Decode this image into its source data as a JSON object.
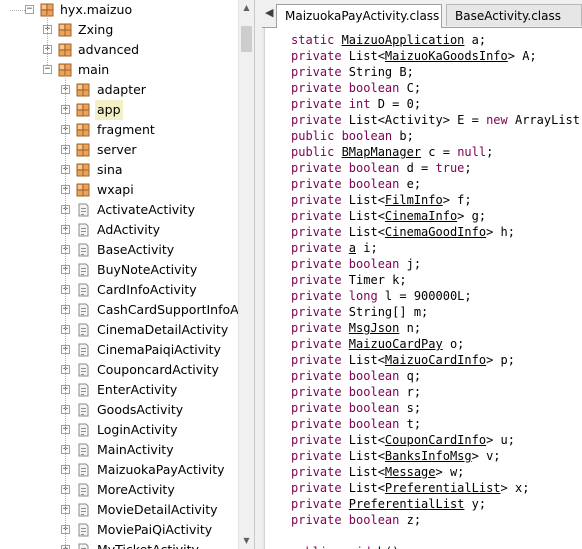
{
  "package_explorer": {
    "root": "hyx.maizuo",
    "packages": [
      {
        "label": "Zxing",
        "level": 1
      },
      {
        "label": "advanced",
        "level": 1
      },
      {
        "label": "main",
        "level": 1
      }
    ],
    "main_children": [
      {
        "label": "adapter",
        "type": "package"
      },
      {
        "label": "app",
        "type": "package",
        "selected": true
      },
      {
        "label": "fragment",
        "type": "package"
      },
      {
        "label": "server",
        "type": "package"
      },
      {
        "label": "sina",
        "type": "package"
      },
      {
        "label": "wxapi",
        "type": "package"
      },
      {
        "label": "ActivateActivity",
        "type": "class"
      },
      {
        "label": "AdActivity",
        "type": "class"
      },
      {
        "label": "BaseActivity",
        "type": "class"
      },
      {
        "label": "BuyNoteActivity",
        "type": "class"
      },
      {
        "label": "CardInfoActivity",
        "type": "class"
      },
      {
        "label": "CashCardSupportInfoAc",
        "type": "class"
      },
      {
        "label": "CinemaDetailActivity",
        "type": "class"
      },
      {
        "label": "CinemaPaiqiActivity",
        "type": "class"
      },
      {
        "label": "CouponcardActivity",
        "type": "class"
      },
      {
        "label": "EnterActivity",
        "type": "class"
      },
      {
        "label": "GoodsActivity",
        "type": "class"
      },
      {
        "label": "LoginActivity",
        "type": "class"
      },
      {
        "label": "MainActivity",
        "type": "class"
      },
      {
        "label": "MaizuokaPayActivity",
        "type": "class"
      },
      {
        "label": "MoreActivity",
        "type": "class"
      },
      {
        "label": "MovieDetailActivity",
        "type": "class"
      },
      {
        "label": "MoviePaiQiActivity",
        "type": "class"
      },
      {
        "label": "MyTicketActivity",
        "type": "class"
      }
    ]
  },
  "tabs": [
    {
      "label": "MaizuokaPayActivity.class",
      "active": true
    },
    {
      "label": "BaseActivity.class",
      "active": false
    }
  ],
  "code_lines": [
    [
      {
        "t": "static ",
        "k": 1
      },
      {
        "t": "MaizuoApplication",
        "u": 1
      },
      {
        "t": " a;"
      }
    ],
    [
      {
        "t": "private ",
        "k": 1
      },
      {
        "t": "List<"
      },
      {
        "t": "MaizuoKaGoodsInfo",
        "u": 1
      },
      {
        "t": "> A;"
      }
    ],
    [
      {
        "t": "private ",
        "k": 1
      },
      {
        "t": "String B;"
      }
    ],
    [
      {
        "t": "private ",
        "k": 1
      },
      {
        "t": "boolean ",
        "k": 1
      },
      {
        "t": "C;"
      }
    ],
    [
      {
        "t": "private ",
        "k": 1
      },
      {
        "t": "int ",
        "k": 1
      },
      {
        "t": "D = 0;"
      }
    ],
    [
      {
        "t": "private ",
        "k": 1
      },
      {
        "t": "List<Activity> E = "
      },
      {
        "t": "new ",
        "k": 1
      },
      {
        "t": "ArrayList();"
      }
    ],
    [
      {
        "t": "public ",
        "k": 1
      },
      {
        "t": "boolean ",
        "k": 1
      },
      {
        "t": "b;"
      }
    ],
    [
      {
        "t": "public ",
        "k": 1
      },
      {
        "t": "BMapManager",
        "u": 1
      },
      {
        "t": " c = "
      },
      {
        "t": "null",
        "k": 1
      },
      {
        "t": ";"
      }
    ],
    [
      {
        "t": "private ",
        "k": 1
      },
      {
        "t": "boolean ",
        "k": 1
      },
      {
        "t": "d = "
      },
      {
        "t": "true",
        "k": 1
      },
      {
        "t": ";"
      }
    ],
    [
      {
        "t": "private ",
        "k": 1
      },
      {
        "t": "boolean ",
        "k": 1
      },
      {
        "t": "e;"
      }
    ],
    [
      {
        "t": "private ",
        "k": 1
      },
      {
        "t": "List<"
      },
      {
        "t": "FilmInfo",
        "u": 1
      },
      {
        "t": "> f;"
      }
    ],
    [
      {
        "t": "private ",
        "k": 1
      },
      {
        "t": "List<"
      },
      {
        "t": "CinemaInfo",
        "u": 1
      },
      {
        "t": "> g;"
      }
    ],
    [
      {
        "t": "private ",
        "k": 1
      },
      {
        "t": "List<"
      },
      {
        "t": "CinemaGoodInfo",
        "u": 1
      },
      {
        "t": "> h;"
      }
    ],
    [
      {
        "t": "private ",
        "k": 1
      },
      {
        "t": "a",
        "u": 1
      },
      {
        "t": " i;"
      }
    ],
    [
      {
        "t": "private ",
        "k": 1
      },
      {
        "t": "boolean ",
        "k": 1
      },
      {
        "t": "j;"
      }
    ],
    [
      {
        "t": "private ",
        "k": 1
      },
      {
        "t": "Timer k;"
      }
    ],
    [
      {
        "t": "private ",
        "k": 1
      },
      {
        "t": "long ",
        "k": 1
      },
      {
        "t": "l = 900000L;"
      }
    ],
    [
      {
        "t": "private ",
        "k": 1
      },
      {
        "t": "String[] m;"
      }
    ],
    [
      {
        "t": "private ",
        "k": 1
      },
      {
        "t": "MsgJson",
        "u": 1
      },
      {
        "t": " n;"
      }
    ],
    [
      {
        "t": "private ",
        "k": 1
      },
      {
        "t": "MaizuoCardPay",
        "u": 1
      },
      {
        "t": " o;"
      }
    ],
    [
      {
        "t": "private ",
        "k": 1
      },
      {
        "t": "List<"
      },
      {
        "t": "MaizuoCardInfo",
        "u": 1
      },
      {
        "t": "> p;"
      }
    ],
    [
      {
        "t": "private ",
        "k": 1
      },
      {
        "t": "boolean ",
        "k": 1
      },
      {
        "t": "q;"
      }
    ],
    [
      {
        "t": "private ",
        "k": 1
      },
      {
        "t": "boolean ",
        "k": 1
      },
      {
        "t": "r;"
      }
    ],
    [
      {
        "t": "private ",
        "k": 1
      },
      {
        "t": "boolean ",
        "k": 1
      },
      {
        "t": "s;"
      }
    ],
    [
      {
        "t": "private ",
        "k": 1
      },
      {
        "t": "boolean ",
        "k": 1
      },
      {
        "t": "t;"
      }
    ],
    [
      {
        "t": "private ",
        "k": 1
      },
      {
        "t": "List<"
      },
      {
        "t": "CouponCardInfo",
        "u": 1
      },
      {
        "t": "> u;"
      }
    ],
    [
      {
        "t": "private ",
        "k": 1
      },
      {
        "t": "List<"
      },
      {
        "t": "BanksInfoMsg",
        "u": 1
      },
      {
        "t": "> v;"
      }
    ],
    [
      {
        "t": "private ",
        "k": 1
      },
      {
        "t": "List<"
      },
      {
        "t": "Message",
        "u": 1
      },
      {
        "t": "> w;"
      }
    ],
    [
      {
        "t": "private ",
        "k": 1
      },
      {
        "t": "List<"
      },
      {
        "t": "PreferentialList",
        "u": 1
      },
      {
        "t": "> x;"
      }
    ],
    [
      {
        "t": "private ",
        "k": 1
      },
      {
        "t": "PreferentialList",
        "u": 1
      },
      {
        "t": " y;"
      }
    ],
    [
      {
        "t": "private ",
        "k": 1
      },
      {
        "t": "boolean ",
        "k": 1
      },
      {
        "t": "z;"
      }
    ],
    [
      {
        "t": ""
      }
    ],
    [
      {
        "t": "public ",
        "k": 1
      },
      {
        "t": "void ",
        "k": 1
      },
      {
        "t": "b()"
      }
    ]
  ]
}
